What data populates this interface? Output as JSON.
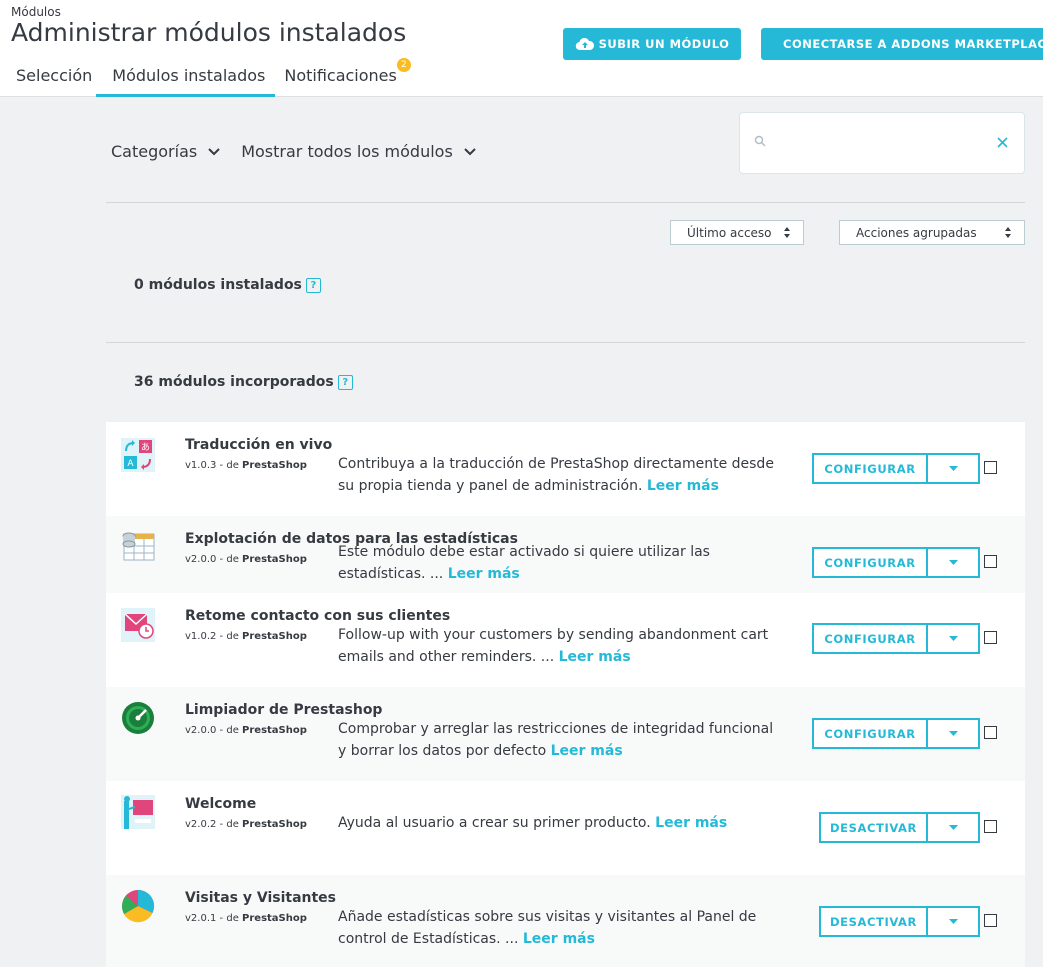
{
  "header": {
    "breadcrumb": "Módulos",
    "title": "Administrar módulos instalados",
    "upload_button": "SUBIR UN MÓDULO",
    "connect_button": "CONECTARSE A ADDONS MARKETPLACE",
    "tabs": [
      {
        "label": "Selección",
        "active": false
      },
      {
        "label": "Módulos instalados",
        "active": true
      },
      {
        "label": "Notificaciones",
        "active": false,
        "badge": "2"
      }
    ]
  },
  "filters": {
    "categories": "Categorías",
    "show": "Mostrar todos los módulos"
  },
  "search": {
    "value": "",
    "placeholder": ""
  },
  "sort": {
    "label": "Último acceso"
  },
  "bulk": {
    "label": "Acciones agrupadas"
  },
  "sections": {
    "installed": "0 módulos instalados",
    "builtin": "36 módulos incorporados",
    "help": "?"
  },
  "modules": [
    {
      "name": "Traducción en vivo",
      "version": "v1.0.3",
      "by": " - de ",
      "author": "PrestaShop",
      "description": "Contribuya a la traducción de PrestaShop directamente desde su propia tienda y panel de administración.",
      "read_more": "Leer más",
      "action": "CONFIGURAR",
      "icon": "translation-icon"
    },
    {
      "name": "Explotación de datos para las estadísticas",
      "version": "v2.0.0",
      "by": " - de ",
      "author": "PrestaShop",
      "description": "Este módulo debe estar activado si quiere utilizar las estadísticas. ...",
      "read_more": "Leer más",
      "action": "CONFIGURAR",
      "icon": "data-table-icon"
    },
    {
      "name": "Retome contacto con sus clientes",
      "version": "v1.0.2",
      "by": " - de ",
      "author": "PrestaShop",
      "description": "Follow-up with your customers by sending abandonment cart emails and other reminders. ...",
      "read_more": "Leer más",
      "action": "CONFIGURAR",
      "icon": "mail-clock-icon"
    },
    {
      "name": "Limpiador de Prestashop",
      "version": "v2.0.0",
      "by": " - de ",
      "author": "PrestaShop",
      "description": "Comprobar y arreglar las restricciones de integridad funcional y borrar los datos por defecto",
      "read_more": "Leer más",
      "action": "CONFIGURAR",
      "icon": "cleaner-icon"
    },
    {
      "name": "Welcome",
      "version": "v2.0.2",
      "by": " - de ",
      "author": "PrestaShop",
      "description": "Ayuda al usuario a crear su primer producto.",
      "read_more": "Leer más",
      "action": "DESACTIVAR",
      "icon": "welcome-icon"
    },
    {
      "name": "Visitas y Visitantes",
      "version": "v2.0.1",
      "by": " - de ",
      "author": "PrestaShop",
      "description": "Añade estadísticas sobre sus visitas y visitantes al Panel de control de Estadísticas. ...",
      "read_more": "Leer más",
      "action": "DESACTIVAR",
      "icon": "pie-chart-icon"
    }
  ],
  "colors": {
    "accent": "#25b9d7",
    "text": "#363a41",
    "background": "#eff1f2"
  }
}
